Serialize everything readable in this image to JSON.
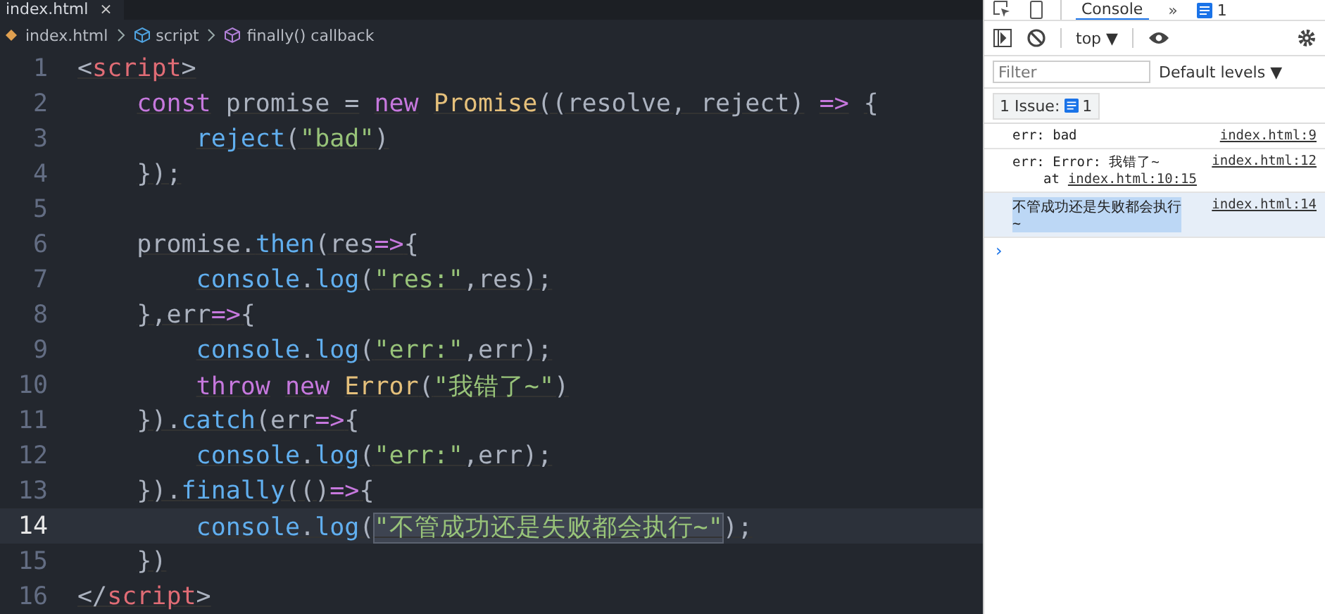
{
  "editor": {
    "tab": {
      "label": "index.html",
      "close": "×"
    },
    "breadcrumb": [
      {
        "label": "index.html",
        "kind": "file"
      },
      {
        "label": "script",
        "kind": "element"
      },
      {
        "label": "finally() callback",
        "kind": "method"
      }
    ],
    "lines": [
      {
        "number": "1",
        "current": false,
        "top": true,
        "tokens": [
          {
            "kind": "punct",
            "text": "<"
          },
          {
            "kind": "tag",
            "text": "script"
          },
          {
            "kind": "punct",
            "text": ">"
          }
        ]
      },
      {
        "number": "2",
        "current": false,
        "children": [
          {
            "kind": "keyword",
            "text": "const"
          },
          {
            "kind": "spaced-plain",
            "text": "promise ="
          },
          {
            "kind": "spaced-keyword",
            "text": "new"
          },
          {
            "kind": "spaced-class",
            "text": "Promise"
          },
          {
            "kind": "plain",
            "text": "((resolve, reject)"
          },
          {
            "kind": "spaced-arrow",
            "text": "=>"
          },
          {
            "kind": "spaced-plain",
            "text": "{"
          }
        ]
      },
      {
        "number": "3",
        "current": false,
        "children": [
          {
            "kind": "nested",
            "children": [
              {
                "kind": "method",
                "text": "reject"
              },
              {
                "kind": "plain",
                "text": "("
              },
              {
                "kind": "string",
                "text": "\"bad\""
              },
              {
                "kind": "plain",
                "text": ")"
              }
            ]
          }
        ]
      },
      {
        "number": "4",
        "current": false,
        "children": [
          {
            "kind": "plain",
            "text": "});"
          }
        ]
      },
      {
        "number": "5",
        "current": false
      },
      {
        "number": "6",
        "current": false,
        "children": [
          {
            "kind": "plain",
            "text": "promise."
          },
          {
            "kind": "method",
            "text": "then"
          },
          {
            "kind": "plain",
            "text": "(res"
          },
          {
            "kind": "arrow",
            "text": "=>"
          },
          {
            "kind": "plain",
            "text": "{"
          }
        ]
      },
      {
        "number": "7",
        "current": false,
        "children": [
          {
            "kind": "nested",
            "children": [
              {
                "kind": "method",
                "text": "console"
              },
              {
                "kind": "plain",
                "text": "."
              },
              {
                "kind": "method",
                "text": "log"
              },
              {
                "kind": "plain",
                "text": "("
              },
              {
                "kind": "string",
                "text": "\"res:\""
              },
              {
                "kind": "plain",
                "text": ",res);"
              }
            ]
          }
        ]
      },
      {
        "number": "8",
        "current": false,
        "children": [
          {
            "kind": "plain",
            "text": "},err"
          },
          {
            "kind": "arrow",
            "text": "=>"
          },
          {
            "kind": "plain",
            "text": "{"
          }
        ]
      },
      {
        "number": "9",
        "current": false,
        "children": [
          {
            "kind": "nested",
            "children": [
              {
                "kind": "method",
                "text": "console"
              },
              {
                "kind": "plain",
                "text": "."
              },
              {
                "kind": "method",
                "text": "log"
              },
              {
                "kind": "plain",
                "text": "("
              },
              {
                "kind": "string",
                "text": "\"err:\""
              },
              {
                "kind": "plain",
                "text": ",err);"
              }
            ]
          }
        ]
      },
      {
        "number": "10",
        "current": false,
        "children": [
          {
            "kind": "nested",
            "children": [
              {
                "kind": "keyword",
                "text": "throw"
              },
              {
                "kind": "spaced-keyword",
                "text": "new"
              },
              {
                "kind": "spaced-class",
                "text": "Error"
              },
              {
                "kind": "plain",
                "text": "("
              },
              {
                "kind": "string",
                "text": "\"我错了~\""
              },
              {
                "kind": "plain",
                "text": ")"
              }
            ]
          }
        ]
      },
      {
        "number": "11",
        "current": false,
        "children": [
          {
            "kind": "plain",
            "text": "})."
          },
          {
            "kind": "method",
            "text": "catch"
          },
          {
            "kind": "plain",
            "text": "(err"
          },
          {
            "kind": "arrow",
            "text": "=>"
          },
          {
            "kind": "plain",
            "text": "{"
          }
        ]
      },
      {
        "number": "12",
        "current": false,
        "children": [
          {
            "kind": "nested",
            "children": [
              {
                "kind": "method",
                "text": "console"
              },
              {
                "kind": "plain",
                "text": "."
              },
              {
                "kind": "method",
                "text": "log"
              },
              {
                "kind": "plain",
                "text": "("
              },
              {
                "kind": "string",
                "text": "\"err:\""
              },
              {
                "kind": "plain",
                "text": ",err);"
              }
            ]
          }
        ]
      },
      {
        "number": "13",
        "current": false,
        "children": [
          {
            "kind": "plain",
            "text": "})."
          },
          {
            "kind": "method",
            "text": "finally"
          },
          {
            "kind": "plain",
            "text": "(()"
          },
          {
            "kind": "arrow",
            "text": "=>"
          },
          {
            "kind": "plain",
            "text": "{"
          }
        ]
      },
      {
        "number": "14",
        "current": true,
        "children": [
          {
            "kind": "nested",
            "children": [
              {
                "kind": "method",
                "text": "console"
              },
              {
                "kind": "plain",
                "text": "."
              },
              {
                "kind": "method",
                "text": "log"
              },
              {
                "kind": "plain",
                "text": "("
              },
              {
                "kind": "selected-string",
                "text": "\"不管成功还是失败都会执行~\""
              },
              {
                "kind": "plain",
                "text": ");"
              }
            ]
          }
        ]
      },
      {
        "number": "15",
        "current": false,
        "children": [
          {
            "kind": "plain",
            "text": "})"
          }
        ]
      },
      {
        "number": "16",
        "current": false,
        "top": true,
        "tokens": [
          {
            "kind": "punct",
            "text": "</"
          },
          {
            "kind": "tag",
            "text": "script"
          },
          {
            "kind": "punct",
            "text": ">"
          }
        ]
      }
    ]
  },
  "devtools": {
    "tabs": [
      {
        "label": "Console",
        "selected": true
      },
      {
        "label": "»",
        "selected": false
      }
    ],
    "issues_badge": "1",
    "context": "top ▼",
    "filter": {
      "placeholder": "Filter"
    },
    "levels": "Default levels ▼",
    "issue_button": {
      "label": "1 Issue:",
      "count": "1"
    },
    "messages": [
      {
        "text": "err: bad",
        "source": "index.html:9",
        "selected": false
      },
      {
        "text": "err: Error: 我错了~",
        "source": "index.html:12",
        "trace_prefix": "at",
        "trace_link": "index.html:10:15",
        "selected": false
      },
      {
        "text": "不管成功还是失败都会执行\n~",
        "source": "index.html:14",
        "selected": true
      }
    ],
    "prompt": "›"
  }
}
